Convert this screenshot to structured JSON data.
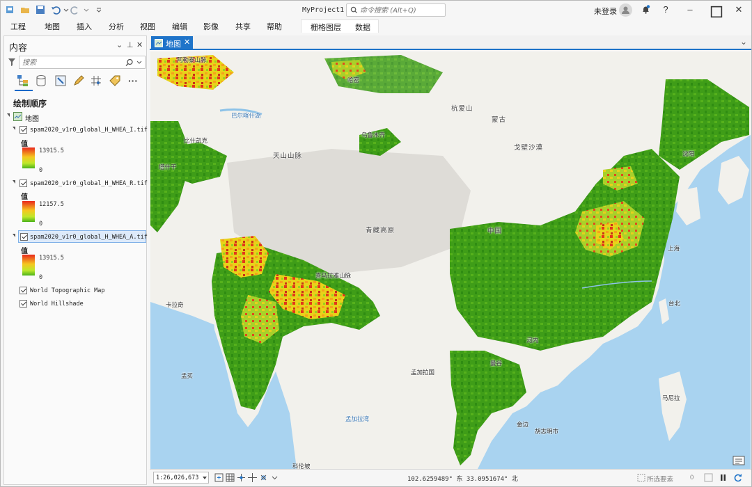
{
  "app": {
    "project_title": "MyProject1",
    "command_search_placeholder": "命令搜索 (Alt+Q)",
    "user_label": "未登录"
  },
  "ribbon": {
    "tabs": [
      "工程",
      "地图",
      "插入",
      "分析",
      "视图",
      "编辑",
      "影像",
      "共享",
      "帮助"
    ],
    "contextual_tabs": [
      "栅格图层",
      "数据"
    ]
  },
  "contents": {
    "title": "内容",
    "search_placeholder": "搜索",
    "draw_order_label": "绘制顺序",
    "map_name": "地图",
    "layers": [
      {
        "name": "spam2020_v1r0_global_H_WHEA_I.tif",
        "value_label": "值",
        "max": "13915.5",
        "min": "0",
        "checked": true,
        "selected": false
      },
      {
        "name": "spam2020_v1r0_global_H_WHEA_R.tif",
        "value_label": "值",
        "max": "12157.5",
        "min": "0",
        "checked": true,
        "selected": false
      },
      {
        "name": "spam2020_v1r0_global_H_WHEA_A.tif",
        "value_label": "值",
        "max": "13915.5",
        "min": "0",
        "checked": true,
        "selected": true
      }
    ],
    "basemaps": [
      {
        "name": "World Topographic Map",
        "checked": true
      },
      {
        "name": "World Hillshade",
        "checked": true
      }
    ]
  },
  "map_tab": {
    "label": "地图"
  },
  "map_labels": {
    "aletai": "阿勒泰山脉",
    "balkhash": "巴尔喀什湖",
    "hami": "哈密",
    "tianshan": "天山山脉",
    "urumqi": "乌鲁木齐",
    "bishkek": "比什凯克",
    "tashkent": "塔什干",
    "mongolia": "蒙古",
    "gobi": "戈壁沙漠",
    "hangai": "杭爱山",
    "qinghai_tibet": "青藏高原",
    "himalaya": "喜马拉雅山脉",
    "china": "中国",
    "shenyang": "沈阳",
    "shanghai": "上海",
    "taipei": "台北",
    "hanoi": "河内",
    "bangkok": "曼谷",
    "manila": "马尼拉",
    "phnompenh": "金边",
    "hcmc": "胡志明市",
    "bay_of_bengal": "孟加拉湾",
    "mumbai": "孟买",
    "colombo": "科伦坡",
    "karachi": "卡拉奇",
    "bangladesh": "孟加拉国"
  },
  "status": {
    "scale": "1:26,026,673",
    "coordinates": "102.6259489° 东 33.0951674° 北",
    "selected_features_label": "所选要素",
    "selected_count": "0"
  }
}
